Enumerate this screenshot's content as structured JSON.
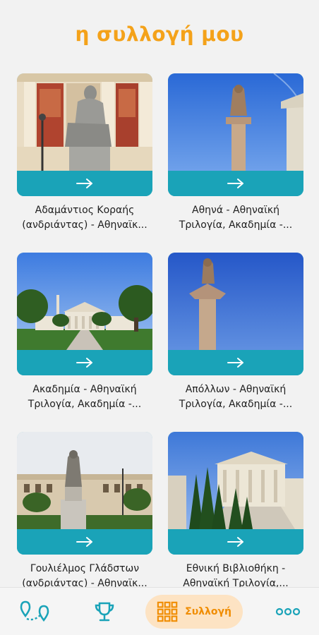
{
  "header": {
    "title": "η συλλογή μου"
  },
  "collection": [
    {
      "name": "Αδαμάντιος Κοραής (ανδριάντας) - Αθηναϊκ...",
      "line1": "Αδαμάντιος Κοραής",
      "line2": "(ανδριάντας) - Αθηναϊκ...",
      "image": "statue-korais"
    },
    {
      "name": "Αθηνά - Αθηναϊκή Τριλογία, Ακαδημία -...",
      "line1": "Αθηνά - Αθηναϊκή",
      "line2": "Τριλογία, Ακαδημία -...",
      "image": "statue-athena"
    },
    {
      "name": "Ακαδημία - Αθηναϊκή Τριλογία, Ακαδημία -...",
      "line1": "Ακαδημία - Αθηναϊκή",
      "line2": "Τριλογία, Ακαδημία -...",
      "image": "academy-building"
    },
    {
      "name": "Απόλλων - Αθηναϊκή Τριλογία, Ακαδημία -...",
      "line1": "Απόλλων - Αθηναϊκή",
      "line2": "Τριλογία, Ακαδημία -...",
      "image": "statue-apollo"
    },
    {
      "name": "Γουλιέλμος Γλάδστων (ανδριάντας) - Αθηναϊκ...",
      "line1": "Γουλιέλμος Γλάδστων",
      "line2": "(ανδριάντας) - Αθηναϊκ...",
      "image": "statue-gladstone"
    },
    {
      "name": "Εθνική Βιβλιοθήκη - Αθηναϊκή Τριλογία,...",
      "line1": "Εθνική Βιβλιοθήκη -",
      "line2": "Αθηναϊκή Τριλογία,...",
      "image": "national-library"
    }
  ],
  "nav": {
    "items": [
      {
        "icon": "map-route-icon"
      },
      {
        "icon": "trophy-icon"
      },
      {
        "icon": "grid-icon",
        "label": "Συλλογή",
        "active": true
      },
      {
        "icon": "more-icon"
      }
    ]
  },
  "colors": {
    "accent": "#f4a21a",
    "teal": "#1aa3b8",
    "activeBg": "#fde3c3",
    "activeText": "#f08c00"
  }
}
